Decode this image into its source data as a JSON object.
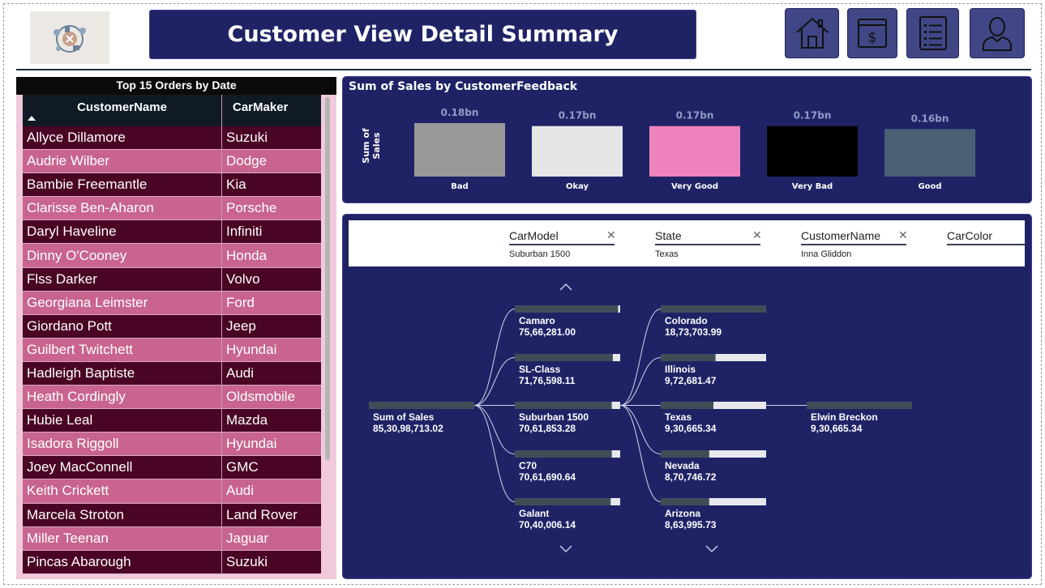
{
  "header": {
    "title": "Customer View Detail Summary",
    "nav": [
      {
        "name": "home-icon"
      },
      {
        "name": "dollar-icon"
      },
      {
        "name": "document-list-icon"
      },
      {
        "name": "user-icon"
      }
    ]
  },
  "table": {
    "title": "Top 15 Orders by Date",
    "columns": [
      "CustomerName",
      "CarMaker"
    ],
    "rows": [
      [
        "Allyce Dillamore",
        "Suzuki"
      ],
      [
        "Audrie Wilber",
        "Dodge"
      ],
      [
        "Bambie Freemantle",
        "Kia"
      ],
      [
        "Clarisse Ben-Aharon",
        "Porsche"
      ],
      [
        "Daryl Haveline",
        "Infiniti"
      ],
      [
        "Dinny O'Cooney",
        "Honda"
      ],
      [
        "Flss Darker",
        "Volvo"
      ],
      [
        "Georgiana Leimster",
        "Ford"
      ],
      [
        "Giordano Pott",
        "Jeep"
      ],
      [
        "Guilbert Twitchett",
        "Hyundai"
      ],
      [
        "Hadleigh Baptiste",
        "Audi"
      ],
      [
        "Heath Cordingly",
        "Oldsmobile"
      ],
      [
        "Hubie Leal",
        "Mazda"
      ],
      [
        "Isadora Riggoll",
        "Hyundai"
      ],
      [
        "Joey MacConnell",
        "GMC"
      ],
      [
        "Keith Crickett",
        "Audi"
      ],
      [
        "Marcela Stroton",
        "Land Rover"
      ],
      [
        "Miller Teenan",
        "Jaguar"
      ],
      [
        "Pincas Abarough",
        "Suzuki"
      ]
    ]
  },
  "chart_data": {
    "type": "bar",
    "title": "Sum of Sales by CustomerFeedback",
    "ylabel": "Sum of Sales",
    "xlabel": "",
    "categories": [
      "Bad",
      "Okay",
      "Very Good",
      "Very Bad",
      "Good"
    ],
    "values": [
      0.18,
      0.17,
      0.17,
      0.17,
      0.16
    ],
    "value_labels": [
      "0.18bn",
      "0.17bn",
      "0.17bn",
      "0.17bn",
      "0.16bn"
    ],
    "colors": [
      "#999999",
      "#e6e6e6",
      "#ee82bc",
      "#000000",
      "#4a5e74"
    ],
    "unit": "bn"
  },
  "tree": {
    "filters": [
      {
        "name": "CarModel",
        "value": "Suburban 1500"
      },
      {
        "name": "State",
        "value": "Texas"
      },
      {
        "name": "CustomerName",
        "value": "Inna Gliddon"
      },
      {
        "name": "CarColor",
        "value": ""
      }
    ],
    "root": {
      "label": "Sum of Sales",
      "value": "85,30,98,713.02"
    },
    "level1": [
      {
        "label": "Camaro",
        "value": "75,66,281.00",
        "fill": 0.98
      },
      {
        "label": "SL-Class",
        "value": "71,76,598.11",
        "fill": 0.93
      },
      {
        "label": "Suburban 1500",
        "value": "70,61,853.28",
        "fill": 0.92,
        "selected": true
      },
      {
        "label": "C70",
        "value": "70,61,690.64",
        "fill": 0.92
      },
      {
        "label": "Galant",
        "value": "70,40,006.14",
        "fill": 0.91
      }
    ],
    "level2": [
      {
        "label": "Colorado",
        "value": "18,73,703.99",
        "fill": 1.0
      },
      {
        "label": "Illinois",
        "value": "9,72,681.47",
        "fill": 0.52
      },
      {
        "label": "Texas",
        "value": "9,30,665.34",
        "fill": 0.5,
        "selected": true
      },
      {
        "label": "Nevada",
        "value": "8,70,746.72",
        "fill": 0.46
      },
      {
        "label": "Arizona",
        "value": "8,63,995.73",
        "fill": 0.46
      }
    ],
    "level3": [
      {
        "label": "Elwin Breckon",
        "value": "9,30,665.34",
        "fill": 1.0
      }
    ]
  }
}
